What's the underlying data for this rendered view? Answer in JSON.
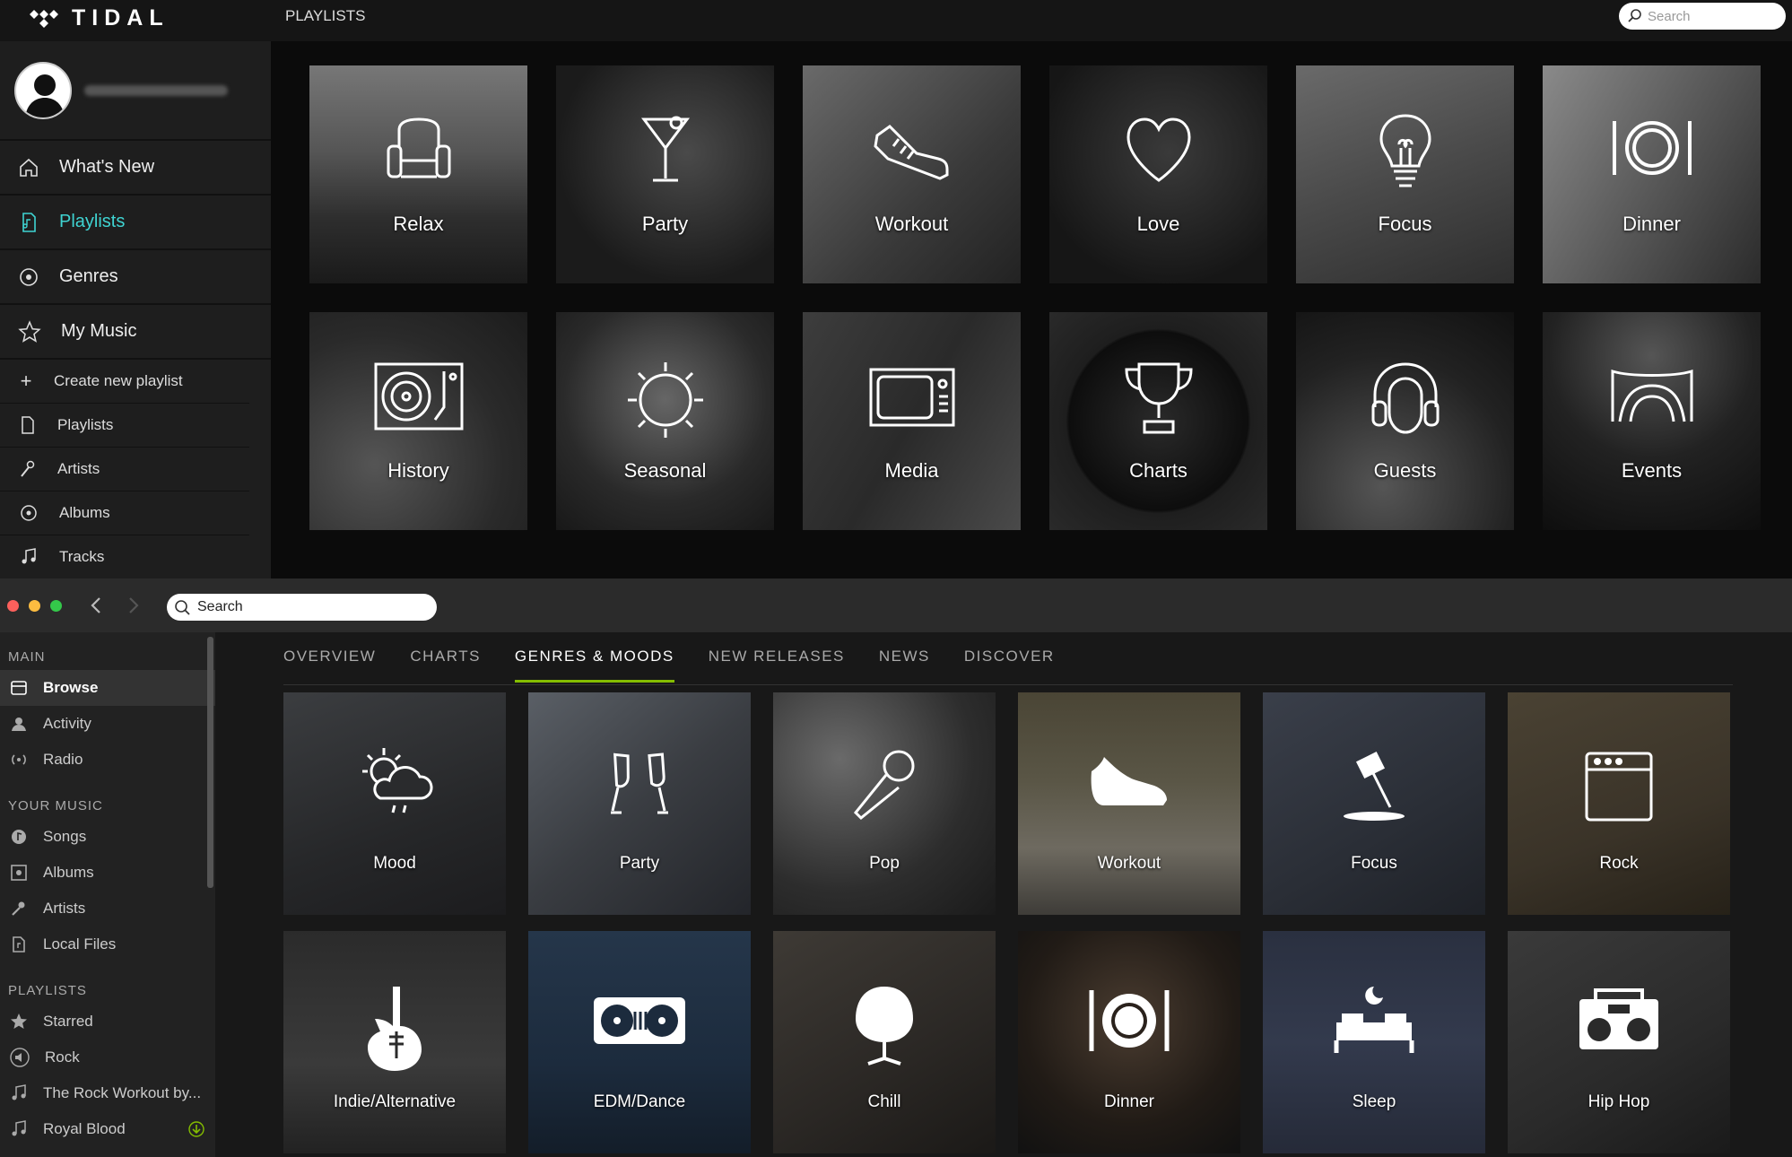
{
  "tidal": {
    "brand": "TIDAL",
    "page_title": "PLAYLISTS",
    "search_placeholder": "Search",
    "nav": [
      {
        "label": "What's New",
        "icon": "home-icon"
      },
      {
        "label": "Playlists",
        "icon": "playlist-icon",
        "active": true
      },
      {
        "label": "Genres",
        "icon": "genres-icon"
      },
      {
        "label": "My Music",
        "icon": "star-icon"
      }
    ],
    "sub_nav": [
      {
        "label": "Create new playlist",
        "icon": "plus-icon"
      },
      {
        "label": "Playlists",
        "icon": "playlist-icon"
      },
      {
        "label": "Artists",
        "icon": "artist-icon"
      },
      {
        "label": "Albums",
        "icon": "album-icon"
      },
      {
        "label": "Tracks",
        "icon": "music-note-icon"
      }
    ],
    "tiles": [
      {
        "label": "Relax",
        "icon": "armchair-icon"
      },
      {
        "label": "Party",
        "icon": "cocktail-icon"
      },
      {
        "label": "Workout",
        "icon": "sneaker-icon"
      },
      {
        "label": "Love",
        "icon": "heart-icon"
      },
      {
        "label": "Focus",
        "icon": "lightbulb-icon"
      },
      {
        "label": "Dinner",
        "icon": "plate-icon"
      },
      {
        "label": "History",
        "icon": "turntable-icon"
      },
      {
        "label": "Seasonal",
        "icon": "sun-icon"
      },
      {
        "label": "Media",
        "icon": "tv-icon"
      },
      {
        "label": "Charts",
        "icon": "trophy-icon"
      },
      {
        "label": "Guests",
        "icon": "headphones-icon"
      },
      {
        "label": "Events",
        "icon": "stage-icon"
      }
    ],
    "accent": "#3fd4d2"
  },
  "spotify": {
    "search_placeholder": "Search",
    "sections": {
      "main": "MAIN",
      "your_music": "YOUR MUSIC",
      "playlists": "PLAYLISTS"
    },
    "main_items": [
      {
        "label": "Browse",
        "icon": "browse-icon",
        "active": true
      },
      {
        "label": "Activity",
        "icon": "activity-icon"
      },
      {
        "label": "Radio",
        "icon": "radio-icon"
      }
    ],
    "music_items": [
      {
        "label": "Songs",
        "icon": "songs-icon"
      },
      {
        "label": "Albums",
        "icon": "album-icon"
      },
      {
        "label": "Artists",
        "icon": "artist-icon"
      },
      {
        "label": "Local Files",
        "icon": "file-icon"
      }
    ],
    "playlist_items": [
      {
        "label": "Starred",
        "icon": "star-icon"
      },
      {
        "label": "Rock",
        "icon": "speaker-icon"
      },
      {
        "label": "The Rock Workout by...",
        "icon": "music-note-icon"
      },
      {
        "label": "Royal Blood",
        "icon": "music-note-icon"
      }
    ],
    "tabs": [
      {
        "label": "OVERVIEW"
      },
      {
        "label": "CHARTS"
      },
      {
        "label": "GENRES & MOODS",
        "active": true
      },
      {
        "label": "NEW RELEASES"
      },
      {
        "label": "NEWS"
      },
      {
        "label": "DISCOVER"
      }
    ],
    "tiles": [
      {
        "label": "Mood",
        "icon": "weather-icon"
      },
      {
        "label": "Party",
        "icon": "champagne-icon"
      },
      {
        "label": "Pop",
        "icon": "microphone-icon"
      },
      {
        "label": "Workout",
        "icon": "sneaker-icon"
      },
      {
        "label": "Focus",
        "icon": "desk-lamp-icon"
      },
      {
        "label": "Rock",
        "icon": "amplifier-icon"
      },
      {
        "label": "Indie/Alternative",
        "icon": "guitar-icon"
      },
      {
        "label": "EDM/Dance",
        "icon": "dj-decks-icon"
      },
      {
        "label": "Chill",
        "icon": "egg-chair-icon"
      },
      {
        "label": "Dinner",
        "icon": "plate-icon"
      },
      {
        "label": "Sleep",
        "icon": "bed-icon"
      },
      {
        "label": "Hip Hop",
        "icon": "boombox-icon"
      }
    ],
    "accent": "#84bd00"
  }
}
